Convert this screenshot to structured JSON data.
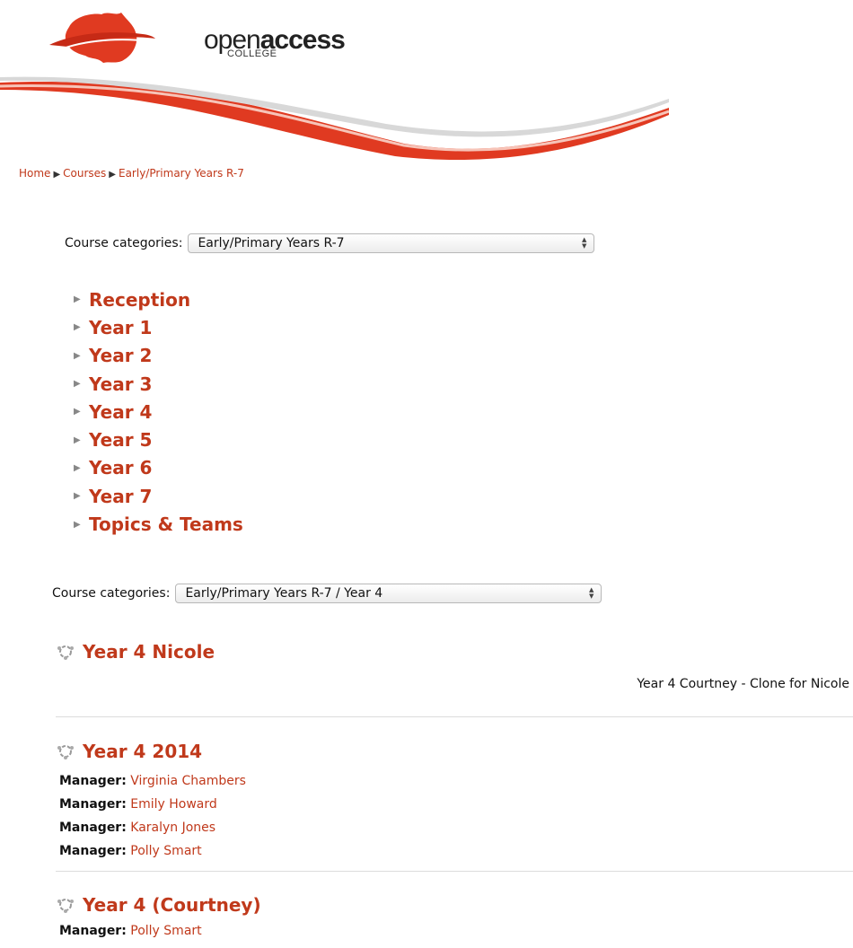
{
  "header": {
    "logo_open": "open",
    "logo_access": "access",
    "logo_college": "COLLEGE"
  },
  "breadcrumb": [
    "Home",
    "Courses",
    "Early/Primary Years R-7"
  ],
  "category_select_1": {
    "label": "Course categories:",
    "value": "Early/Primary Years R-7"
  },
  "subcategories": [
    "Reception",
    "Year 1",
    "Year 2",
    "Year 3",
    "Year 4",
    "Year 5",
    "Year 6",
    "Year 7",
    "Topics & Teams"
  ],
  "category_select_2": {
    "label": "Course categories:",
    "value": "Early/Primary Years R-7 / Year 4"
  },
  "courses": [
    {
      "title": "Year 4 Nicole",
      "summary": "Year 4 Courtney - Clone for Nicole",
      "managers": []
    },
    {
      "title": "Year 4 2014",
      "managers": [
        {
          "role": "Manager:",
          "name": "Virginia Chambers"
        },
        {
          "role": "Manager:",
          "name": "Emily Howard"
        },
        {
          "role": "Manager:",
          "name": "Karalyn Jones"
        },
        {
          "role": "Manager:",
          "name": "Polly Smart"
        }
      ]
    },
    {
      "title": "Year 4 (Courtney)",
      "managers": [
        {
          "role": "Manager:",
          "name": "Polly Smart"
        }
      ]
    }
  ],
  "colors": {
    "brand_red": "#c0391b",
    "logo_red": "#e03a21"
  },
  "icons": {
    "course_icon": "course-icon",
    "expand_icon": "triangle-right-icon",
    "breadcrumb_separator": "triangle-right-icon"
  }
}
